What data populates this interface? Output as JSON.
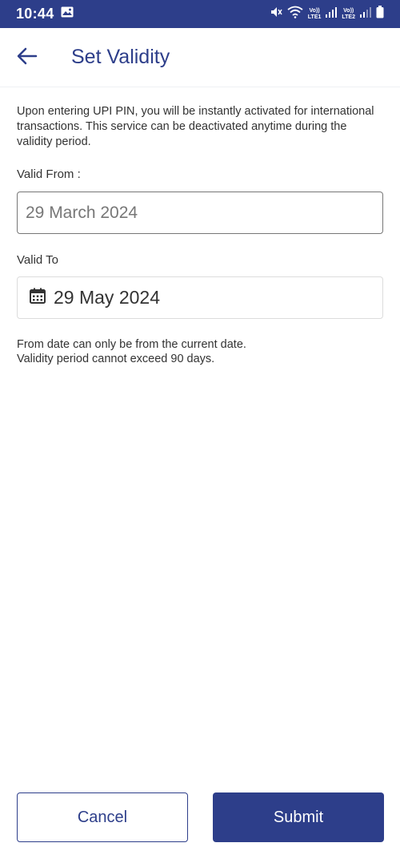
{
  "status_bar": {
    "time": "10:44",
    "sim1_top": "Vo))",
    "sim1_bottom": "LTE1",
    "sim2_top": "Vo))",
    "sim2_bottom": "LTE2"
  },
  "header": {
    "title": "Set Validity"
  },
  "intro_text": "Upon entering UPI PIN, you will be instantly activated for international transactions. This service can be deactivated anytime during the validity period.",
  "valid_from": {
    "label": "Valid From :",
    "value": "29 March 2024"
  },
  "valid_to": {
    "label": "Valid To",
    "value": "29 May 2024"
  },
  "notes": {
    "line1": "From date can only be from the current date.",
    "line2": "Validity period cannot exceed 90 days."
  },
  "actions": {
    "cancel_label": "Cancel",
    "submit_label": "Submit"
  },
  "colors": {
    "primary": "#2d3e8a",
    "text": "#333333",
    "muted": "#777777"
  },
  "icons": {
    "back": "arrow-left-icon",
    "calendar": "calendar-icon"
  }
}
